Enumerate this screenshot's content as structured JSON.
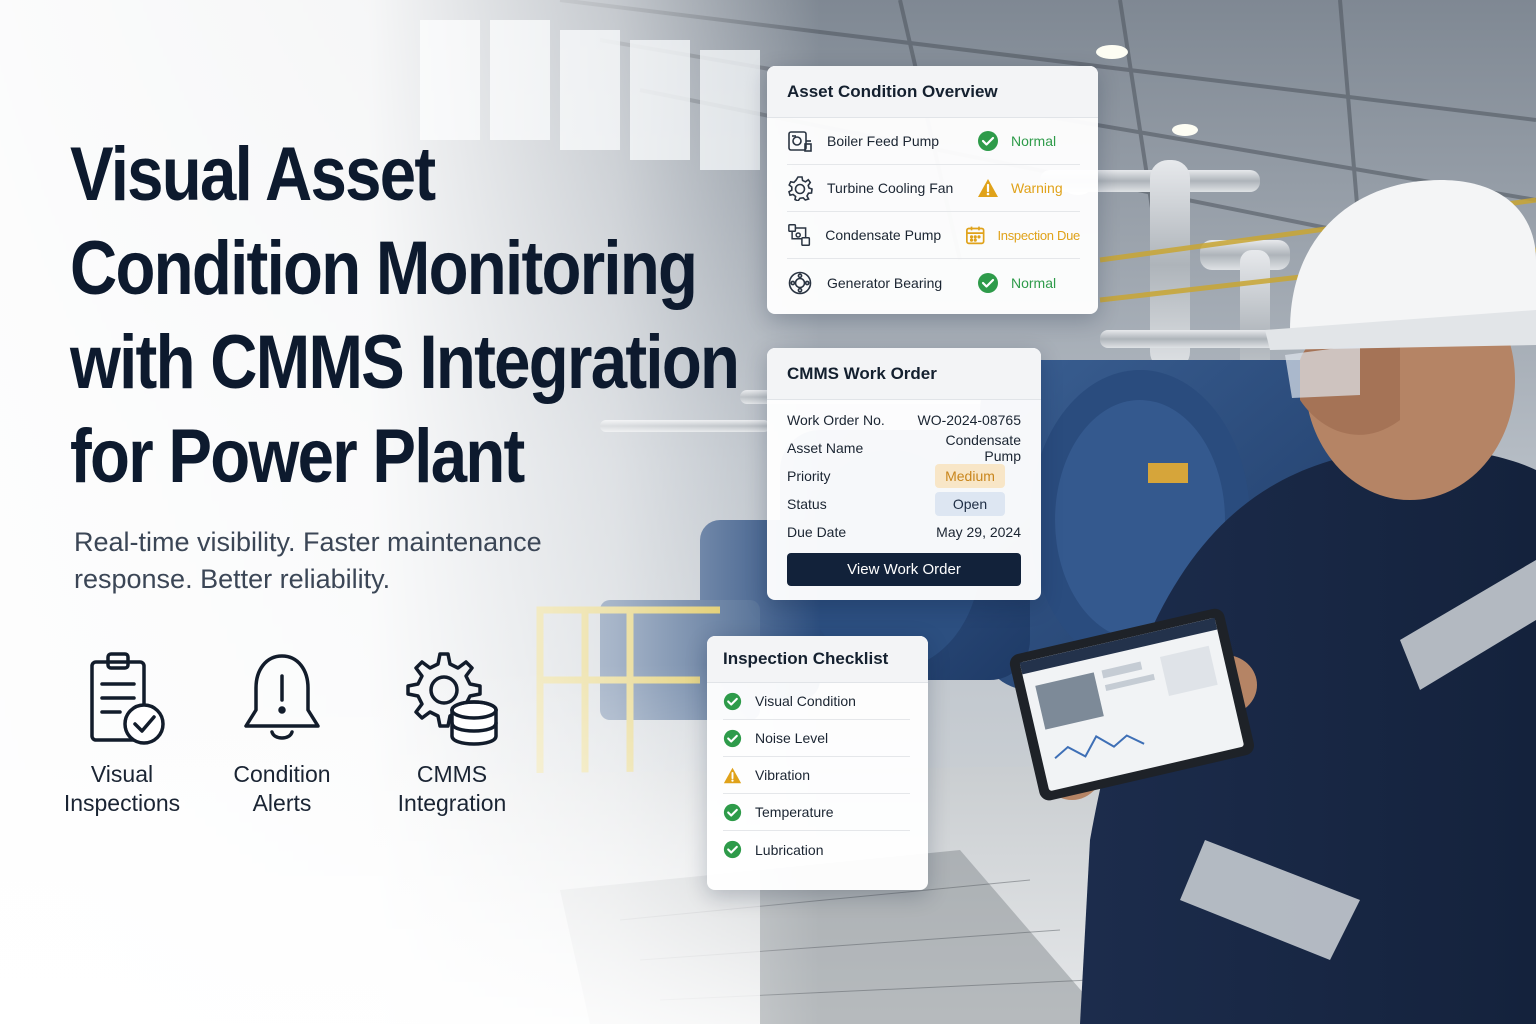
{
  "hero": {
    "title_lines": [
      "Visual Asset",
      "Condition Monitoring",
      "with CMMS Integration",
      "for Power Plant"
    ],
    "subtitle_lines": [
      "Real-time visibility. Faster maintenance",
      "response. Better reliability."
    ]
  },
  "features": [
    {
      "icon": "clipboard-check-icon",
      "lines": [
        "Visual",
        "Inspections"
      ]
    },
    {
      "icon": "bell-alert-icon",
      "lines": [
        "Condition",
        "Alerts"
      ]
    },
    {
      "icon": "gear-database-icon",
      "lines": [
        "CMMS",
        "Integration"
      ]
    }
  ],
  "asset_overview": {
    "title": "Asset Condition Overview",
    "rows": [
      {
        "name": "Boiler Feed Pump",
        "icon": "pump-icon",
        "status": "Normal",
        "status_icon": "check-circle-icon",
        "status_color": "#2e9b4a"
      },
      {
        "name": "Turbine Cooling Fan",
        "icon": "gear-icon",
        "status": "Warning",
        "status_icon": "warning-triangle-icon",
        "status_color": "#e0a21a"
      },
      {
        "name": "Condensate Pump",
        "icon": "piping-icon",
        "status": "Inspection Due",
        "status_icon": "calendar-icon",
        "status_color": "#e0a21a"
      },
      {
        "name": "Generator Bearing",
        "icon": "bearing-icon",
        "status": "Normal",
        "status_icon": "check-circle-icon",
        "status_color": "#2e9b4a"
      }
    ]
  },
  "work_order": {
    "title": "CMMS Work Order",
    "fields": [
      {
        "label": "Work Order No.",
        "value": "WO-2024-08765"
      },
      {
        "label": "Asset Name",
        "value": "Condensate Pump"
      },
      {
        "label": "Priority",
        "value": "Medium"
      },
      {
        "label": "Status",
        "value": "Open"
      },
      {
        "label": "Due Date",
        "value": "May 29, 2024"
      }
    ],
    "button_label": "View Work Order"
  },
  "checklist": {
    "title": "Inspection Checklist",
    "items": [
      {
        "label": "Visual Condition",
        "state": "ok"
      },
      {
        "label": "Noise Level",
        "state": "ok"
      },
      {
        "label": "Vibration",
        "state": "warning"
      },
      {
        "label": "Temperature",
        "state": "ok"
      },
      {
        "label": "Lubrication",
        "state": "ok"
      }
    ]
  },
  "colors": {
    "ok": "#2e9b4a",
    "warning": "#e0a21a",
    "navy": "#12223a",
    "title": "#0d1a2e"
  }
}
